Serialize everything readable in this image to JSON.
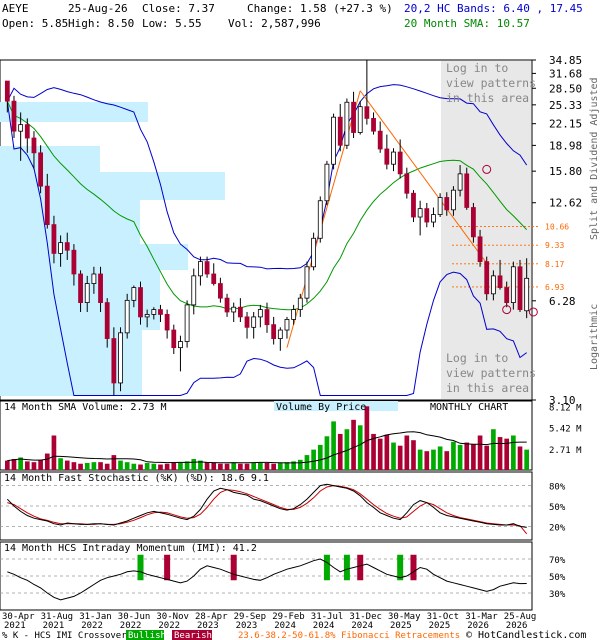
{
  "header": {
    "row1": [
      {
        "text": "AEYE",
        "color": "#000000"
      },
      {
        "text": "25-Aug-26",
        "color": "#000000"
      },
      {
        "text": "Close: 7.37",
        "color": "#000000"
      },
      {
        "text": "Change: 1.58 (+27.3 %)",
        "color": "#000000"
      },
      {
        "text": "20,2 HC Bands: 6.40 , 17.45",
        "color": "#0000cc"
      }
    ],
    "row2": [
      {
        "text": "Open: 5.85",
        "color": "#000000"
      },
      {
        "text": "High: 8.50",
        "color": "#000000"
      },
      {
        "text": "Low: 5.55",
        "color": "#000000"
      },
      {
        "text": "Vol: 2,587,996",
        "color": "#000000"
      },
      {
        "text": "20 Month SMA: 10.57",
        "color": "#008800"
      }
    ]
  },
  "colors": {
    "up": "#00aa00",
    "down": "#aa0033",
    "band": "#0000cc",
    "sma": "#009900",
    "fib": "#ff6600",
    "vbp": "#c8f0ff",
    "shade": "#e8e8e8",
    "trend": "#ff6600"
  },
  "overlays": {
    "login_top": [
      "Log in to",
      "view patterns",
      "in this area"
    ],
    "login_bottom": [
      "Log in to",
      "view patterns",
      "in this area"
    ]
  },
  "side_labels": {
    "right1": "Split and Dividend Adjusted",
    "right2": "Logarithmic"
  },
  "footer": {
    "legend_prefix": "% K - HCS IMI Crossover:",
    "bullish": "Bullish",
    "bearish": "Bearish",
    "fib_text": "23.6-38.2-50-61.8% Fibonacci Retracements",
    "copyright": "© HotCandlestick.com"
  },
  "chart_data": {
    "type": "candlestick",
    "title": "MONTHLY CHART",
    "price_axis_ticks": [
      34.85,
      31.68,
      28.5,
      25.33,
      22.15,
      18.98,
      15.8,
      12.62,
      6.28,
      3.1
    ],
    "fib_levels": [
      10.66,
      9.33,
      8.17,
      6.93
    ],
    "price_range": [
      3.1,
      34.85
    ],
    "x_labels": [
      "30-Apr 2021",
      "31-Aug 2021",
      "31-Jan 2022",
      "30-Jun 2022",
      "30-Nov 2022",
      "28-Apr 2023",
      "29-Sep 2023",
      "29-Feb 2024",
      "31-Jul 2024",
      "31-Dec 2024",
      "30-May 2025",
      "31-Oct 2025",
      "31-Mar 2026",
      "25-Aug 2026"
    ],
    "candles": [
      [
        30,
        30,
        24,
        26
      ],
      [
        26,
        27,
        20,
        21
      ],
      [
        21,
        24,
        17,
        22
      ],
      [
        22,
        23,
        18,
        20
      ],
      [
        20,
        21,
        16,
        18
      ],
      [
        18,
        19,
        13.5,
        14.2
      ],
      [
        14.2,
        15.5,
        10.5,
        10.8
      ],
      [
        10.8,
        11.5,
        8.2,
        8.8
      ],
      [
        8.8,
        10,
        8,
        9.5
      ],
      [
        9.5,
        10.2,
        8.4,
        9.0
      ],
      [
        9.0,
        9.4,
        7.0,
        7.6
      ],
      [
        7.6,
        7.8,
        5.8,
        6.2
      ],
      [
        6.2,
        7.5,
        5.8,
        7.1
      ],
      [
        7.1,
        8.0,
        6.6,
        7.6
      ],
      [
        7.6,
        8.0,
        5.8,
        6.2
      ],
      [
        6.2,
        6.4,
        4.5,
        4.8
      ],
      [
        4.8,
        5.2,
        3.2,
        3.5
      ],
      [
        3.5,
        5.2,
        3.3,
        5.0
      ],
      [
        5.0,
        6.6,
        4.8,
        6.3
      ],
      [
        6.3,
        7.0,
        6.0,
        6.9
      ],
      [
        6.9,
        7.2,
        5.3,
        5.6
      ],
      [
        5.6,
        5.9,
        5.2,
        5.7
      ],
      [
        5.7,
        6.0,
        5.5,
        5.9
      ],
      [
        5.9,
        6.1,
        5.4,
        5.7
      ],
      [
        5.7,
        5.9,
        4.8,
        5.1
      ],
      [
        5.1,
        5.3,
        4.3,
        4.5
      ],
      [
        4.5,
        4.9,
        3.8,
        4.7
      ],
      [
        4.7,
        6.3,
        4.5,
        6.1
      ],
      [
        6.1,
        7.9,
        5.7,
        7.5
      ],
      [
        7.5,
        8.6,
        7.0,
        8.3
      ],
      [
        8.3,
        8.6,
        7.4,
        7.6
      ],
      [
        7.6,
        8.2,
        7.0,
        7.1
      ],
      [
        7.1,
        7.4,
        6.2,
        6.4
      ],
      [
        6.4,
        6.6,
        5.6,
        5.8
      ],
      [
        5.8,
        6.2,
        5.4,
        6.0
      ],
      [
        6.0,
        6.4,
        5.4,
        5.6
      ],
      [
        5.6,
        5.8,
        4.8,
        5.2
      ],
      [
        5.2,
        5.8,
        4.8,
        5.6
      ],
      [
        5.6,
        6.1,
        5.2,
        5.9
      ],
      [
        5.9,
        6.2,
        5.0,
        5.3
      ],
      [
        5.3,
        5.6,
        4.6,
        4.8
      ],
      [
        4.8,
        5.2,
        4.4,
        5.1
      ],
      [
        5.1,
        5.6,
        4.8,
        5.5
      ],
      [
        5.5,
        6.1,
        5.3,
        5.9
      ],
      [
        5.9,
        6.6,
        5.6,
        6.4
      ],
      [
        6.4,
        8.3,
        6.2,
        8.0
      ],
      [
        8.0,
        10.2,
        7.8,
        9.8
      ],
      [
        9.8,
        13.2,
        9.5,
        12.8
      ],
      [
        12.8,
        17.0,
        12.4,
        16.6
      ],
      [
        16.6,
        23.8,
        16.0,
        23.2
      ],
      [
        23.2,
        25.5,
        18.2,
        19.0
      ],
      [
        19.0,
        26.5,
        18.5,
        25.8
      ],
      [
        25.8,
        27.8,
        20.0,
        20.8
      ],
      [
        20.8,
        26.0,
        20.5,
        25.0
      ],
      [
        25.0,
        34.85,
        22.0,
        23.0
      ],
      [
        23.0,
        24.0,
        20.5,
        21.0
      ],
      [
        21.0,
        22.5,
        18.0,
        18.5
      ],
      [
        18.5,
        20.5,
        16.0,
        16.6
      ],
      [
        16.6,
        18.6,
        15.8,
        18.1
      ],
      [
        18.1,
        19.8,
        15.0,
        15.5
      ],
      [
        15.5,
        16.2,
        13.0,
        13.5
      ],
      [
        13.5,
        13.8,
        11.0,
        11.4
      ],
      [
        11.4,
        12.8,
        10.0,
        12.1
      ],
      [
        12.1,
        12.6,
        10.6,
        11.0
      ],
      [
        11.0,
        12.2,
        10.6,
        11.6
      ],
      [
        11.6,
        13.5,
        11.4,
        13.1
      ],
      [
        13.1,
        13.6,
        11.5,
        12.0
      ],
      [
        12.0,
        14.2,
        11.5,
        13.8
      ],
      [
        13.8,
        16.5,
        13.2,
        15.5
      ],
      [
        15.5,
        16.2,
        12.0,
        12.2
      ],
      [
        12.2,
        12.6,
        9.5,
        9.9
      ],
      [
        9.9,
        10.4,
        8.0,
        8.3
      ],
      [
        8.3,
        8.6,
        6.3,
        6.6
      ],
      [
        6.6,
        7.8,
        6.3,
        7.5
      ],
      [
        7.5,
        8.4,
        6.8,
        6.9
      ],
      [
        6.9,
        7.2,
        6.0,
        6.2
      ],
      [
        6.2,
        8.3,
        5.9,
        8.0
      ],
      [
        8.0,
        8.4,
        5.8,
        5.9
      ],
      [
        5.85,
        8.5,
        5.55,
        7.37
      ]
    ],
    "sma_levels": [
      10.57
    ],
    "panels": [
      {
        "label": "14 Month SMA Volume: 2.73 M",
        "ticks": [
          "8.12 M",
          "5.42 M",
          "2.71 M"
        ],
        "center": "Volume By Price",
        "right": "MONTHLY CHART"
      },
      {
        "label": "14 Month Fast Stochastic (%K) (%D): 18.6  9.1",
        "ticks": [
          "80%",
          "50%",
          "20%"
        ]
      },
      {
        "label": "14 Month HCS Intraday Momentum (IMI): 41.2",
        "ticks": [
          "70%",
          "50%",
          "30%"
        ]
      }
    ],
    "volume": [
      1.2,
      1.4,
      1.6,
      1.1,
      1.0,
      1.3,
      2.1,
      4.4,
      1.5,
      1.2,
      1.0,
      0.8,
      0.9,
      1.0,
      1.0,
      0.8,
      1.9,
      1.2,
      1.0,
      0.8,
      0.7,
      0.9,
      0.8,
      0.7,
      0.8,
      0.9,
      1.0,
      1.1,
      1.4,
      1.2,
      1.0,
      0.9,
      0.8,
      0.8,
      0.9,
      0.8,
      0.8,
      0.9,
      1.0,
      0.9,
      0.8,
      0.9,
      1.0,
      1.1,
      1.3,
      1.9,
      2.6,
      3.2,
      4.3,
      6.2,
      4.6,
      5.2,
      6.4,
      5.7,
      8.12,
      4.6,
      4.0,
      4.5,
      3.5,
      3.1,
      4.4,
      3.8,
      2.6,
      2.4,
      2.6,
      3.0,
      2.4,
      3.6,
      3.2,
      3.5,
      3.3,
      4.4,
      3.1,
      5.2,
      4.2,
      4.0,
      4.4,
      3.0,
      2.6
    ],
    "stoch_k": [
      60,
      50,
      42,
      36,
      32,
      30,
      28,
      24,
      22,
      25,
      24,
      23,
      23,
      24,
      24,
      23,
      22,
      25,
      28,
      32,
      36,
      40,
      42,
      40,
      38,
      35,
      32,
      30,
      35,
      45,
      60,
      72,
      76,
      74,
      70,
      68,
      66,
      60,
      58,
      54,
      50,
      46,
      44,
      46,
      52,
      60,
      70,
      80,
      82,
      80,
      78,
      76,
      72,
      65,
      55,
      48,
      40,
      36,
      32,
      30,
      40,
      52,
      58,
      55,
      48,
      40,
      36,
      34,
      32,
      30,
      28,
      26,
      24,
      23,
      22,
      22,
      24,
      20,
      18.6
    ],
    "stoch_d": [
      55,
      52,
      46,
      40,
      35,
      31,
      29,
      26,
      24,
      24,
      24,
      24,
      23,
      23,
      24,
      23,
      23,
      24,
      26,
      29,
      33,
      37,
      40,
      41,
      40,
      37,
      34,
      32,
      33,
      38,
      48,
      60,
      70,
      74,
      73,
      71,
      68,
      64,
      60,
      56,
      52,
      48,
      45,
      45,
      48,
      54,
      62,
      72,
      78,
      80,
      79,
      77,
      74,
      68,
      60,
      52,
      45,
      39,
      35,
      32,
      34,
      42,
      50,
      55,
      52,
      46,
      40,
      36,
      33,
      31,
      29,
      27,
      25,
      24,
      23,
      22,
      22,
      21,
      9.1
    ],
    "imi": [
      55,
      52,
      48,
      45,
      40,
      36,
      30,
      25,
      22,
      24,
      26,
      30,
      35,
      40,
      45,
      48,
      50,
      52,
      55,
      56,
      55,
      52,
      50,
      48,
      46,
      44,
      42,
      44,
      50,
      58,
      62,
      60,
      58,
      55,
      52,
      50,
      48,
      46,
      45,
      48,
      52,
      55,
      58,
      60,
      62,
      65,
      68,
      70,
      66,
      60,
      55,
      58,
      60,
      62,
      64,
      60,
      56,
      52,
      50,
      48,
      50,
      55,
      60,
      58,
      52,
      48,
      44,
      42,
      40,
      38,
      36,
      34,
      32,
      34,
      38,
      40,
      42,
      41,
      41.2
    ]
  }
}
